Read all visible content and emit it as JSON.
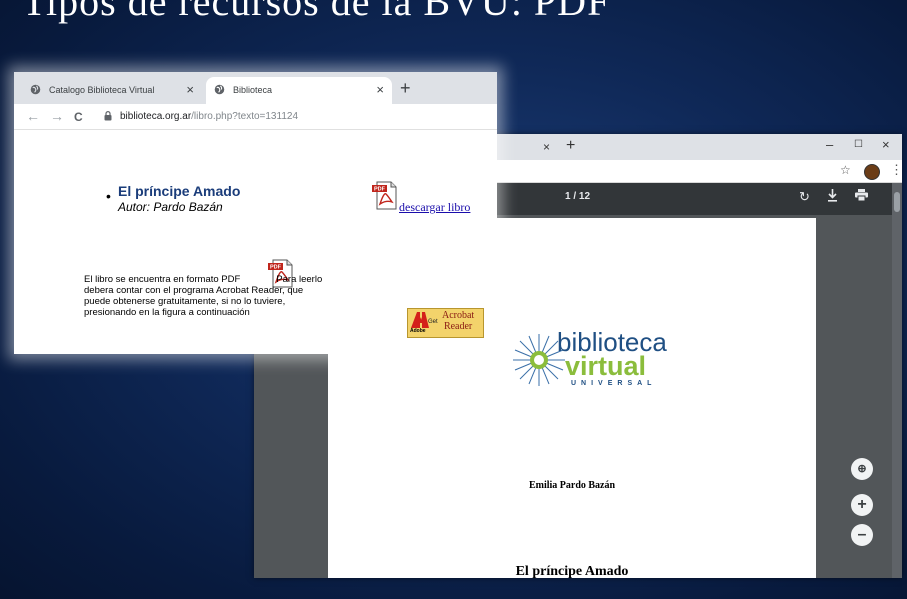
{
  "slide": {
    "title": "Tipos de recursos de la BVU: PDF"
  },
  "back_window": {
    "win_controls": {
      "minimize": "–",
      "maximize": "☐",
      "close": "×"
    },
    "tab_close": "×",
    "new_tab": "+",
    "pdf_viewer": {
      "page_count": "1 / 12",
      "logo": {
        "line1": "biblioteca",
        "line2": "virtual",
        "line3": "UNIVERSAL"
      },
      "author": "Emilia Pardo Bazán",
      "book_title": "El príncipe Amado",
      "zoom_in": "+",
      "zoom_out": "–"
    }
  },
  "front_window": {
    "tabs": [
      {
        "label": "Catalogo Biblioteca Virtual",
        "close": "×",
        "active": false
      },
      {
        "label": "Biblioteca",
        "close": "×",
        "active": true
      }
    ],
    "new_tab": "+",
    "nav": {
      "back": "←",
      "forward": "→",
      "reload": "C"
    },
    "url": {
      "host": "biblioteca.org.ar",
      "path": "/libro.php?texto=131124"
    },
    "content": {
      "bullet": "•",
      "book_title": "El príncipe Amado",
      "author": "Autor: Pardo Bazán",
      "download_link": "descargar libro",
      "info_lines": [
        "El libro se encuentra en formato PDF",
        "Para leerlo",
        "debera contar con el programa Acrobat Reader, que",
        "puede obtenerse gratuitamente, si no lo tuviere,",
        "presionando en la figura a continuación"
      ],
      "acrobat_badge": {
        "get": "Get",
        "line1": "Acrobat",
        "line2": "Reader",
        "adobe": "Adobe"
      }
    }
  },
  "icons": [
    "globe-icon",
    "lock-icon",
    "pdf-file-icon",
    "rotate-icon",
    "download-icon",
    "print-icon",
    "star-icon",
    "kebab-icon",
    "fit-page-icon"
  ],
  "colors": {
    "slide_bg": "#0f2857",
    "title_link": "#1a3c7a",
    "link": "#1a0dab",
    "pdf_toolbar": "#323639",
    "pdf_bg": "#525659",
    "logo_blue": "#1f4f83",
    "logo_green": "#8bbd3c"
  }
}
